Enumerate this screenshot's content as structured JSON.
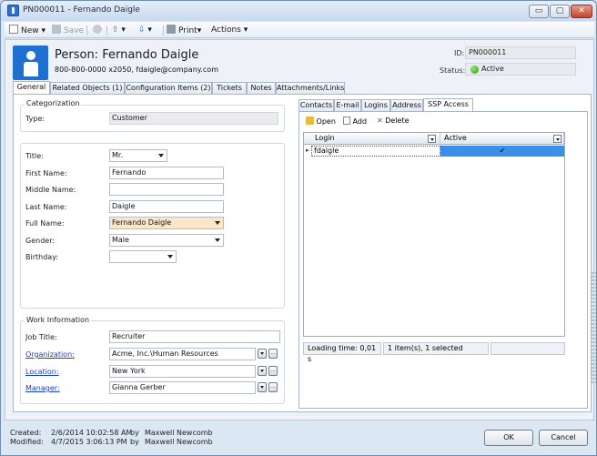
{
  "window": {
    "title": "PN000011 - Fernando Daigle",
    "controls": {
      "minimize": "▭",
      "maximize": "▢",
      "close": "✕"
    }
  },
  "toolbar": {
    "new_label": "New",
    "save_label": "Save",
    "print_label": "Print",
    "actions_label": "Actions"
  },
  "header": {
    "title": "Person: Fernando Daigle",
    "subtitle": "800-800-0000 x2050, fdaigle@company.com",
    "id_label": "ID:",
    "id_value": "PN000011",
    "status_label": "Status:",
    "status_value": "Active",
    "status_color": "#2ea31f"
  },
  "tabs": [
    {
      "label": "General",
      "active": true
    },
    {
      "label": "Related Objects (1)"
    },
    {
      "label": "Configuration Items (2)"
    },
    {
      "label": "Tickets"
    },
    {
      "label": "Notes"
    },
    {
      "label": "Attachments/Links"
    }
  ],
  "categorization": {
    "group_label": "Categorization",
    "type_label": "Type:",
    "type_value": "Customer"
  },
  "identity": {
    "title_label": "Title:",
    "title_value": "Mr.",
    "first_name_label": "First Name:",
    "first_name_value": "Fernando",
    "middle_name_label": "Middle Name:",
    "middle_name_value": "",
    "last_name_label": "Last Name:",
    "last_name_value": "Daigle",
    "full_name_label": "Full Name:",
    "full_name_value": "Fernando Daigle",
    "gender_label": "Gender:",
    "gender_value": "Male",
    "birthday_label": "Birthday:",
    "birthday_value": ""
  },
  "work": {
    "group_label": "Work Information",
    "job_title_label": "Job Title:",
    "job_title_value": "Recruiter",
    "organization_label": "Organization:",
    "organization_value": "Acme, Inc.\\Human Resources",
    "location_label": "Location:",
    "location_value": "New York",
    "manager_label": "Manager:",
    "manager_value": "Gianna Gerber"
  },
  "subtabs": [
    {
      "label": "Contacts"
    },
    {
      "label": "E-mail"
    },
    {
      "label": "Logins"
    },
    {
      "label": "Address"
    },
    {
      "label": "SSP Access",
      "active": true
    }
  ],
  "ssp": {
    "open_label": "Open",
    "add_label": "Add",
    "delete_label": "Delete",
    "columns": [
      "Login",
      "Active"
    ],
    "rows": [
      {
        "login": "fdaigle",
        "active": "✔"
      }
    ],
    "loading_time": "Loading time: 0,01 s",
    "item_count": "1 item(s), 1 selected"
  },
  "footer": {
    "created_label": "Created:",
    "created_date": "2/6/2014 10:02:58 AM",
    "created_by_label": "by",
    "created_by": "Maxwell Newcomb",
    "modified_label": "Modified:",
    "modified_date": "4/7/2015 3:06:13 PM",
    "modified_by_label": "by",
    "modified_by": "Maxwell Newcomb",
    "ok_label": "OK",
    "cancel_label": "Cancel"
  }
}
